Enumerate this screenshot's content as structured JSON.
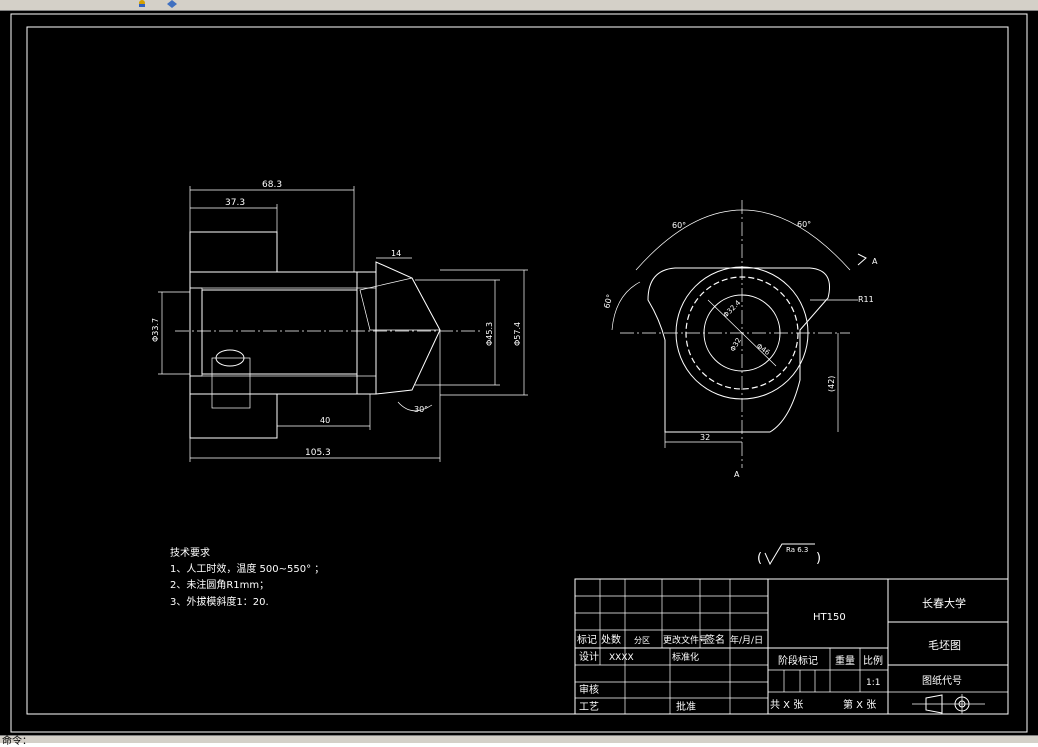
{
  "colors": {
    "background": "#000000",
    "lines": "#ffffff",
    "ui_chrome": "#d4d0c8"
  },
  "icons": [
    "toolbar-icon",
    "arrow-icon",
    "roughness-symbol-icon",
    "projection-symbol-icon"
  ],
  "status_text": "命令：",
  "drawing": {
    "front_view": {
      "dims": {
        "overall_top": "68.3",
        "flange_width": "37.3",
        "slot": "14",
        "bore_dia": "Φ33.7",
        "dia_mid": "Φ45.3",
        "dia_outer": "Φ57.4",
        "inner_len": "40",
        "overall_len": "105.3",
        "chamfer_angle": "30°"
      }
    },
    "side_view": {
      "dims": {
        "angle_left": "60°",
        "angle_right": "60°",
        "angle_side": "60°",
        "radius": "R11",
        "dia_a": "Φ32.4",
        "dia_b": "Φ32",
        "dia_c": "Φ46",
        "height": "(42)",
        "width": "32"
      },
      "section_mark_a": "A",
      "section_mark_b": "A"
    },
    "roughness": "Ra 6.3",
    "tech_requirements": {
      "title": "技术要求",
      "items": [
        "1、人工时效，温度 500~550° ；",
        "2、未注圆角R1mm；",
        "3、外拔模斜度1：20."
      ]
    },
    "title_block": {
      "material": "HT150",
      "university": "长春大学",
      "drawing_name": "毛坯图",
      "drawing_code_label": "图纸代号",
      "header_row": [
        "标记",
        "处数",
        "分区",
        "更改文件号",
        "签名",
        "年/月/日"
      ],
      "design_label": "设计",
      "design_value": "XXXX",
      "standardize_label": "标准化",
      "review_label": "审核",
      "process_label": "工艺",
      "approve_label": "批准",
      "stage_mark_label": "阶段标记",
      "weight_label": "重量",
      "scale_label": "比例",
      "scale_value": "1:1",
      "total_sheets": "共 X 张",
      "sheet_no": "第 X 张"
    }
  }
}
